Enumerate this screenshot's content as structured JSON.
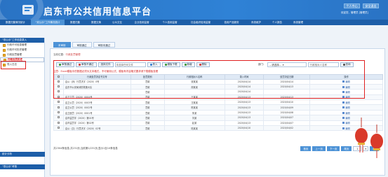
{
  "header": {
    "title": "启东市公共信用信息平台",
    "btn_personal": "个人中心",
    "btn_logout": "安全退出",
    "welcome": "欢迎您，管理员 [管理员]"
  },
  "nav": {
    "items": [
      "数据归集情况统计",
      "“双公示”工作情况统计",
      "数据归集",
      "数据交换",
      "公众交互",
      "企业信用监管",
      "个人信用监管",
      "社会组织信用监管",
      "信用产品服务",
      "系统维护",
      "个人报告",
      "系统管理"
    ],
    "active_index": 1
  },
  "sidebar": {
    "header": "“双公示”工作信息录入",
    "items": [
      "行政许可信息管理",
      "行政许可历史管理",
      "行政处罚管理",
      "行政处罚历史",
      "导入日志"
    ],
    "selected_index": 3,
    "bottom1": "统计分析",
    "bottom2": "“双公示”考核"
  },
  "tabs": [
    "未审核",
    "审核通过",
    "审核未通过"
  ],
  "breadcrumb": {
    "prefix": "当前位置：",
    "path": "行政处罚管理"
  },
  "toolbar": {
    "approve": "审核通过",
    "reject": "审核不通过",
    "choose_file": "选择文件",
    "file_placeholder": "未选择任何文件",
    "import": "导入",
    "template": "模板下载",
    "add": "新增",
    "delete": "删除",
    "dept_label": "部门：",
    "dept_value": "---请选择---",
    "search_placeholder": "行政相对人名称",
    "query": "查询"
  },
  "note": "注意：Excel模板中的数据必须为文本格式，不可使用公式，模板有内容格式要求请下载模板查看",
  "table": {
    "headers": [
      "",
      "行政处罚决定书文号",
      "处罚类别",
      "行政相对人名称",
      "录入时间",
      "处罚决定日期",
      "操作"
    ],
    "rows": [
      [
        "启公（消）行罚决字〔2020〕0号",
        "罚款",
        "张某某",
        "2020/04/14",
        "2020/04/14",
        "编辑"
      ],
      [
        "启东市公安局消防救援大队",
        "罚款",
        "周某某",
        "2020/04/14",
        "2020/04/13",
        "编辑"
      ],
      [
        "",
        "罚款",
        "",
        "2020/04/14",
        "",
        "编辑"
      ],
      [
        "启卫立罚〔2020〕0004号",
        "罚款",
        "王某某",
        "2020/04/13",
        "2020/04/13",
        "编辑"
      ],
      [
        "启卫公罚〔2020〕0003号",
        "罚款",
        "汪某某",
        "2020/04/13",
        "2020/04/10",
        "编辑"
      ],
      [
        "启卫公罚〔2020〕0002号",
        "罚款",
        "陈某某",
        "2020/04/13",
        "2020/04/09",
        "编辑"
      ],
      [
        "启卫医罚〔2020〕0001号",
        "罚款",
        "朱某",
        "2020/04/13",
        "2020/04/08",
        "编辑"
      ],
      [
        "启市监罚字〔2020〕第01号",
        "罚款",
        "刘某",
        "2020/04/13",
        "2020/04/07",
        "编辑"
      ],
      [
        "启市监罚字〔2020〕第02号",
        "罚款",
        "赵某",
        "2020/04/13",
        "2020/04/07",
        "编辑"
      ],
      [
        "启公（交）行罚决字〔2020〕02号",
        "罚款",
        "陆某某",
        "2020/04/10",
        "2020/04/02",
        "编辑"
      ]
    ],
    "edit_label": "编辑"
  },
  "footer": {
    "summary": "共2304条信息,共231页,当前第1/231页,显示1至10条信息",
    "first": "首页",
    "prev": "上一页",
    "next": "下一页",
    "last": "尾页",
    "page_value": "1",
    "go": "Go"
  },
  "colors": {
    "banner": "#2f82d6",
    "nav": "#1d5ea8",
    "accent": "#4c92d6",
    "highlight": "#e02020"
  }
}
